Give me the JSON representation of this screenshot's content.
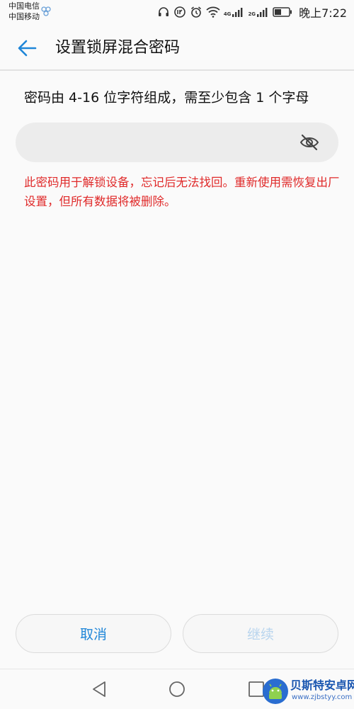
{
  "status_bar": {
    "carrier_1": "中国电信",
    "carrier_2": "中国移动",
    "network_1": "4G",
    "network_2": "2G",
    "time": "晚上7:22"
  },
  "header": {
    "title": "设置锁屏混合密码"
  },
  "body": {
    "hint": "密码由 4-16 位字符组成，需至少包含 1 个字母",
    "password_value": "",
    "warning": "此密码用于解锁设备，忘记后无法找回。重新使用需恢复出厂设置，但所有数据将被删除。"
  },
  "buttons": {
    "cancel": "取消",
    "continue": "继续"
  },
  "watermark": {
    "name": "贝斯特安卓网",
    "url": "www.zjbstyy.com"
  },
  "colors": {
    "accent": "#1f86d8",
    "warning": "#e02a2a",
    "disabled": "#b9d5ee"
  }
}
